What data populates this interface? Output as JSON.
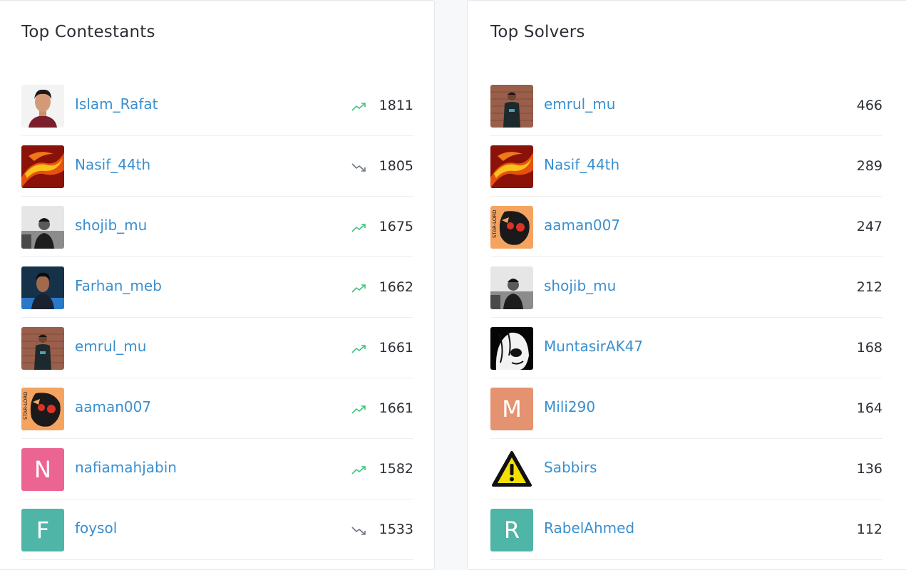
{
  "colors": {
    "link": "#3a8fcf",
    "trend_up": "#3cc47c",
    "trend_down": "#707780"
  },
  "contestants": {
    "title": "Top Contestants",
    "rows": [
      {
        "name": "Islam_Rafat",
        "rating": "1811",
        "trend": "up",
        "avatar": "photo-face"
      },
      {
        "name": "Nasif_44th",
        "rating": "1805",
        "trend": "down",
        "avatar": "fire"
      },
      {
        "name": "shojib_mu",
        "rating": "1675",
        "trend": "up",
        "avatar": "photo-bw"
      },
      {
        "name": "Farhan_meb",
        "rating": "1662",
        "trend": "up",
        "avatar": "photo-blue"
      },
      {
        "name": "emrul_mu",
        "rating": "1661",
        "trend": "up",
        "avatar": "photo-brick"
      },
      {
        "name": "aaman007",
        "rating": "1661",
        "trend": "up",
        "avatar": "starlord"
      },
      {
        "name": "nafiamahjabin",
        "rating": "1582",
        "trend": "up",
        "avatar": "letter",
        "letter": "N",
        "bg": "#ec6592"
      },
      {
        "name": "foysol",
        "rating": "1533",
        "trend": "down",
        "avatar": "letter",
        "letter": "F",
        "bg": "#4fb5a7"
      }
    ]
  },
  "solvers": {
    "title": "Top Solvers",
    "rows": [
      {
        "name": "emrul_mu",
        "solved": "466",
        "avatar": "photo-brick"
      },
      {
        "name": "Nasif_44th",
        "solved": "289",
        "avatar": "fire"
      },
      {
        "name": "aaman007",
        "solved": "247",
        "avatar": "starlord"
      },
      {
        "name": "shojib_mu",
        "solved": "212",
        "avatar": "photo-bw"
      },
      {
        "name": "MuntasirAK47",
        "solved": "168",
        "avatar": "anime"
      },
      {
        "name": "Mili290",
        "solved": "164",
        "avatar": "letter",
        "letter": "M",
        "bg": "#e49270"
      },
      {
        "name": "Sabbirs",
        "solved": "136",
        "avatar": "warning"
      },
      {
        "name": "RabelAhmed",
        "solved": "112",
        "avatar": "letter",
        "letter": "R",
        "bg": "#4fb5a7"
      }
    ]
  }
}
